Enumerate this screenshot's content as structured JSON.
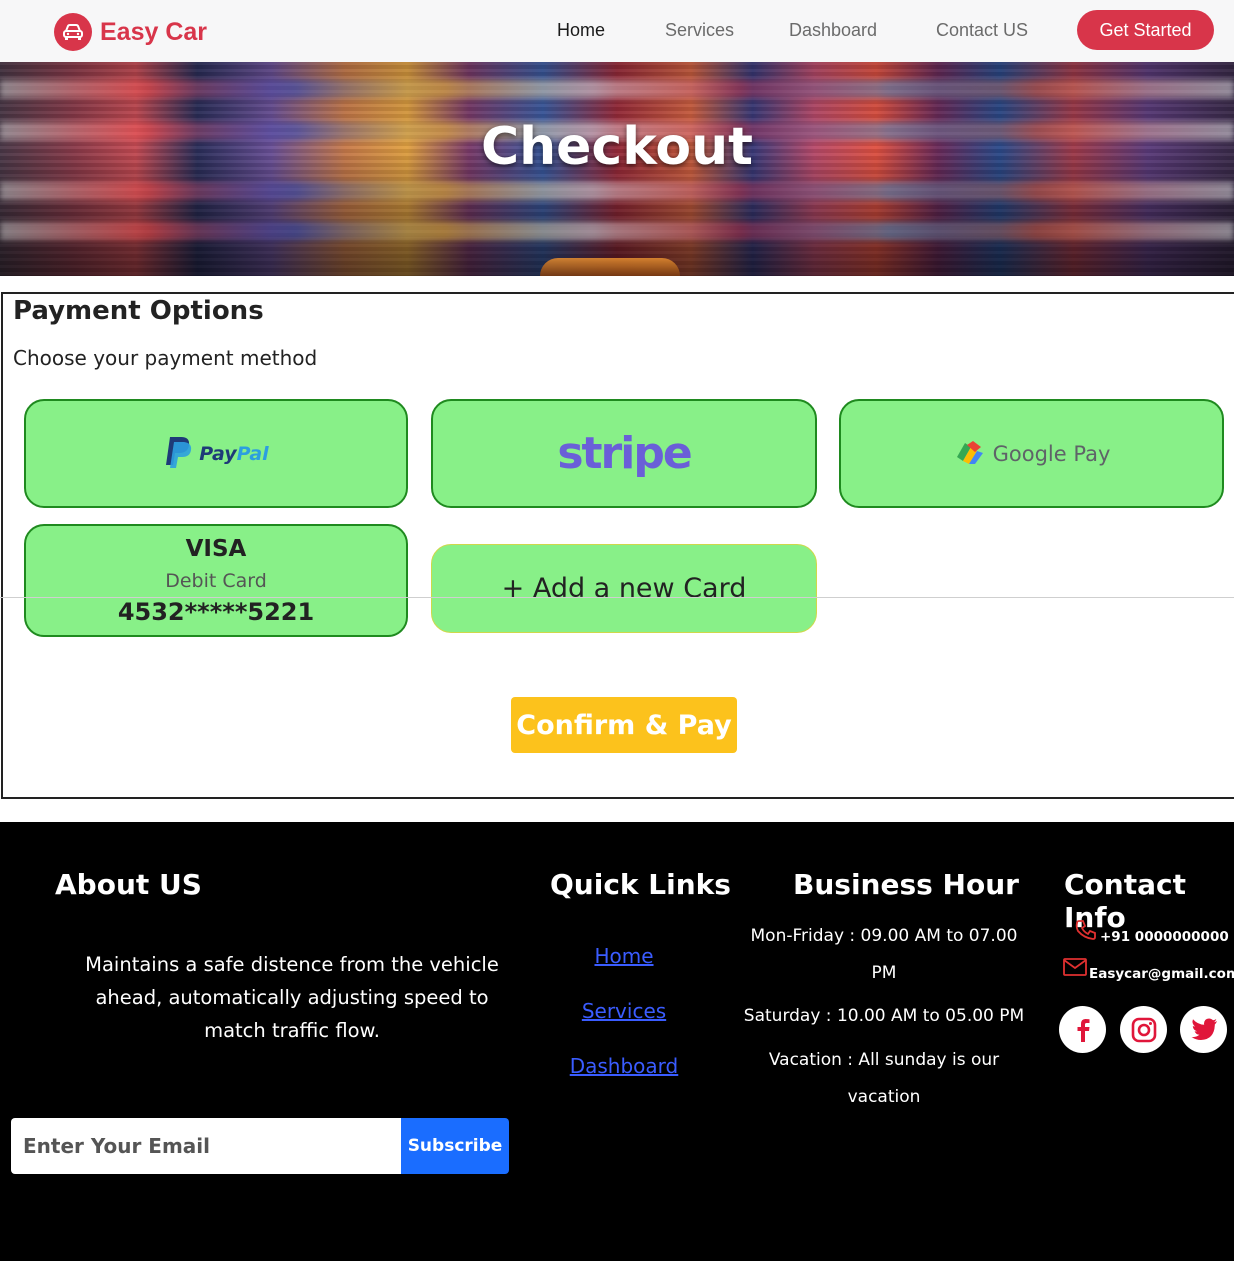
{
  "brand": {
    "name": "Easy Car",
    "accent": "#d8354a"
  },
  "nav": {
    "items": [
      {
        "label": "Home"
      },
      {
        "label": "Services"
      },
      {
        "label": "Dashboard"
      },
      {
        "label": "Contact US"
      }
    ],
    "cta_label": "Get Started"
  },
  "hero": {
    "title": "Checkout"
  },
  "payment": {
    "title": "Payment Options",
    "subtitle": "Choose your payment method",
    "options": {
      "paypal": {
        "word1": "Pay",
        "word2": "Pal"
      },
      "stripe": {
        "label": "stripe"
      },
      "gpay": {
        "label": "Google Pay"
      },
      "visa": {
        "brand": "VISA",
        "type": "Debit Card",
        "number": "4532*****5221"
      },
      "add_card": {
        "label": "+ Add a new Card"
      }
    },
    "confirm_label": "Confirm & Pay",
    "option_bg": "#88f088",
    "confirm_bg": "#fcc21c"
  },
  "footer": {
    "about": {
      "heading": "About US",
      "text": "Maintains a safe distence from the vehicle ahead, automatically adjusting speed to match traffic flow."
    },
    "quick_links": {
      "heading": "Quick Links",
      "links": [
        "Home",
        "Services",
        "Dashboard"
      ]
    },
    "business_hour": {
      "heading": "Business Hour",
      "lines": [
        "Mon-Friday : 09.00 AM to 07.00 PM",
        "Saturday : 10.00 AM to 05.00 PM",
        "Vacation : All sunday is our vacation"
      ]
    },
    "contact": {
      "heading": "Contact Info",
      "phone": "+91 0000000000",
      "email": "Easycar@gmail.com",
      "social_icons": [
        "facebook-icon",
        "instagram-icon",
        "twitter-icon"
      ]
    },
    "newsletter": {
      "placeholder": "Enter Your Email",
      "button_label": "Subscribe"
    }
  }
}
